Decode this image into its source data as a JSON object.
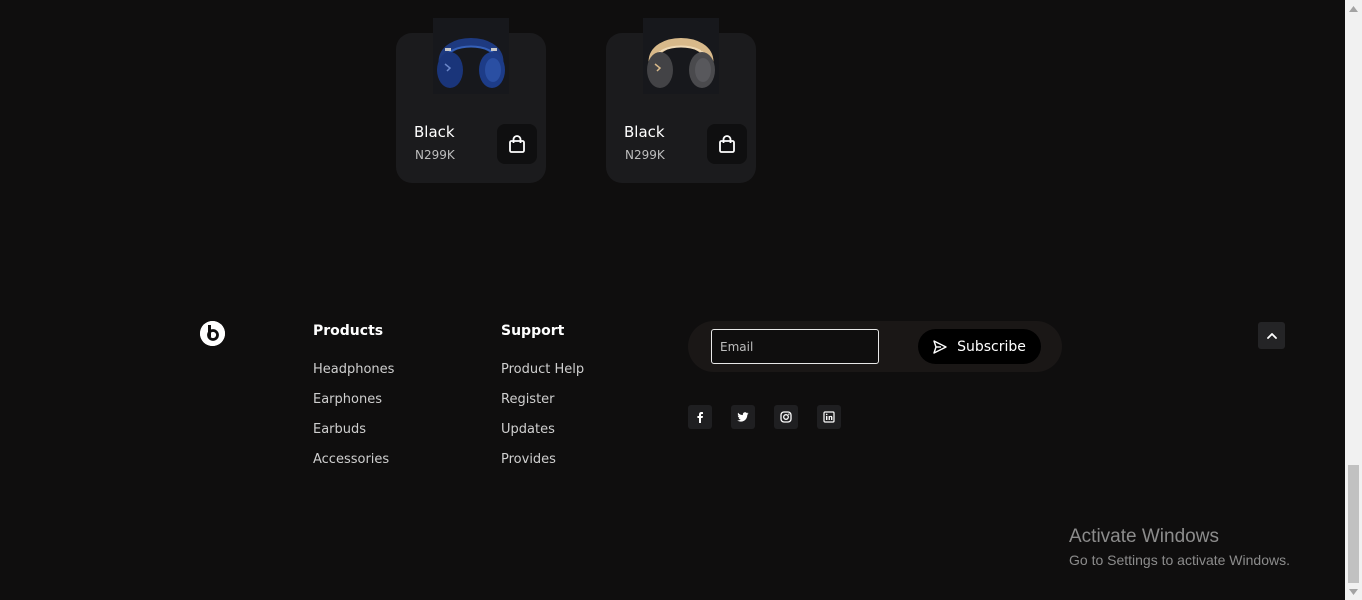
{
  "products": [
    {
      "title": "Black",
      "price": "N299K",
      "image_icon": "headphones-blue-icon",
      "color": "#1f3f8a"
    },
    {
      "title": "Black",
      "price": "N299K",
      "image_icon": "headphones-gray-gold-icon",
      "color": "#4a4a4d"
    }
  ],
  "footer": {
    "logo_icon": "beats-logo-icon",
    "products_col": {
      "title": "Products",
      "links": [
        "Headphones",
        "Earphones",
        "Earbuds",
        "Accessories"
      ]
    },
    "support_col": {
      "title": "Support",
      "links": [
        "Product Help",
        "Register",
        "Updates",
        "Provides"
      ]
    },
    "subscribe": {
      "email_placeholder": "Email",
      "email_value": "",
      "button_label": "Subscribe",
      "button_icon": "send-icon"
    },
    "socials": [
      "facebook-icon",
      "twitter-icon",
      "instagram-icon",
      "linkedin-icon"
    ],
    "back_to_top_icon": "chevron-up-icon"
  },
  "watermark": {
    "title": "Activate Windows",
    "subtitle": "Go to Settings to activate Windows."
  },
  "colors": {
    "background": "#0f0e0e",
    "card": "#1b1b1d",
    "accent_gold": "#d8b98a"
  }
}
